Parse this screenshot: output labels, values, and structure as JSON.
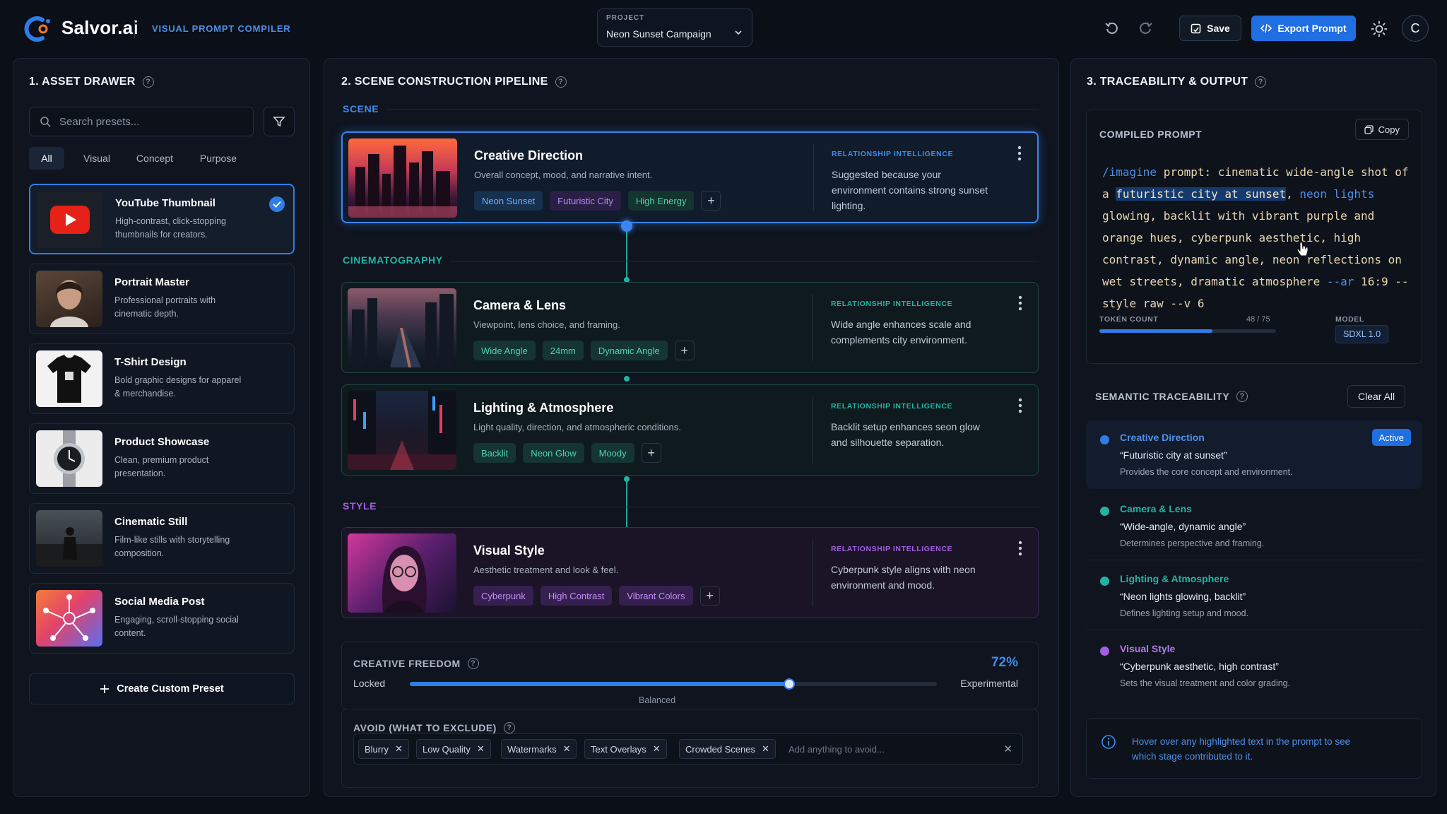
{
  "header": {
    "brand": "Salvor.ai",
    "subtitle": "VISUAL PROMPT COMPILER",
    "project_label": "PROJECT",
    "project_value": "Neon Sunset Campaign",
    "save_label": "Save",
    "export_label": "Export Prompt",
    "avatar_initial": "C"
  },
  "asset_drawer": {
    "title": "1. ASSET DRAWER",
    "search_placeholder": "Search presets...",
    "filters": [
      "All",
      "Visual",
      "Concept",
      "Purpose"
    ],
    "presets": [
      {
        "name": "YouTube Thumbnail",
        "desc": "High-contrast, click-stopping thumbnails for creators.",
        "selected": true
      },
      {
        "name": "Portrait Master",
        "desc": "Professional portraits with cinematic depth."
      },
      {
        "name": "T-Shirt Design",
        "desc": "Bold graphic designs for apparel & merchandise."
      },
      {
        "name": "Product Showcase",
        "desc": "Clean, premium product presentation."
      },
      {
        "name": "Cinematic Still",
        "desc": "Film-like stills with storytelling composition."
      },
      {
        "name": "Social Media Post",
        "desc": "Engaging, scroll-stopping social content."
      }
    ],
    "create_label": "Create Custom Preset"
  },
  "pipeline": {
    "title": "2. SCENE CONSTRUCTION PIPELINE",
    "sections": {
      "scene": "SCENE",
      "cinematography": "CINEMATOGRAPHY",
      "style": "STYLE"
    },
    "ri_label": "RELATIONSHIP INTELLIGENCE",
    "stages": [
      {
        "name": "Creative Direction",
        "desc": "Overall concept, mood, and narrative intent.",
        "tags": [
          "Neon Sunset",
          "Futuristic City",
          "High Energy"
        ],
        "ri": "Suggested because your environment contains strong sunset lighting."
      },
      {
        "name": "Camera & Lens",
        "desc": "Viewpoint, lens choice, and framing.",
        "tags": [
          "Wide Angle",
          "24mm",
          "Dynamic Angle"
        ],
        "ri": "Wide angle enhances scale and complements city environment."
      },
      {
        "name": "Lighting & Atmosphere",
        "desc": "Light quality, direction, and atmospheric conditions.",
        "tags": [
          "Backlit",
          "Neon Glow",
          "Moody"
        ],
        "ri": "Backlit setup enhances seon glow and silhouette separation."
      },
      {
        "name": "Visual Style",
        "desc": "Aesthetic treatment and look & feel.",
        "tags": [
          "Cyberpunk",
          "High Contrast",
          "Vibrant Colors"
        ],
        "ri": "Cyberpunk style aligns with neon environment and mood."
      }
    ],
    "freedom": {
      "label": "CREATIVE FREEDOM",
      "value_text": "72%",
      "value": 0.72,
      "left": "Locked",
      "right": "Experimental",
      "mid": "Balanced"
    },
    "avoid": {
      "label": "AVOID (WHAT TO EXCLUDE)",
      "chips": [
        "Blurry",
        "Low Quality",
        "Watermarks",
        "Text Overlays",
        "Crowded Scenes"
      ],
      "placeholder": "Add anything to avoid..."
    }
  },
  "output": {
    "title": "3. TRACEABILITY & OUTPUT",
    "compiled_label": "COMPILED PROMPT",
    "copy_label": "Copy",
    "prompt": {
      "cmd": "/imagine",
      "p1": " prompt: cinematic wide-angle shot of a ",
      "highlight": "futuristic city at sunset",
      "p2": ", ",
      "neon": "neon lights",
      "p3": " glowing, backlit with vibrant purple and orange hues, cyberpunk aesthetic, high contrast, dynamic angle, neon reflections on wet streets, dramatic atmosphere ",
      "ar": "--ar",
      "p4": " 16:9 --style raw --v 6"
    },
    "token_label": "TOKEN COUNT",
    "token_text": "48 / 75",
    "token_fraction": 0.64,
    "model_label": "MODEL",
    "model_value": "SDXL 1.0",
    "semantic_label": "SEMANTIC TRACEABILITY",
    "clear_label": "Clear All",
    "traces": [
      {
        "name": "Creative Direction",
        "quote": "“Futuristic city at sunset”",
        "desc": "Provides the core concept and environment.",
        "color": "#2f7de6",
        "badge": "Active"
      },
      {
        "name": "Camera & Lens",
        "quote": "“Wide-angle, dynamic angle”",
        "desc": "Determines perspective and framing.",
        "color": "#22b3a4"
      },
      {
        "name": "Lighting & Atmosphere",
        "quote": "“Neon lights glowing, backlit”",
        "desc": "Defines lighting setup and mood.",
        "color": "#22b3a4"
      },
      {
        "name": "Visual Style",
        "quote": "“Cyberpunk aesthetic, high contrast”",
        "desc": "Sets the visual treatment and color grading.",
        "color": "#a35ee0"
      }
    ],
    "hint": "Hover over any highlighted text in the prompt to see which stage contributed to it."
  },
  "colors": {
    "accent": "#1f6fe3",
    "teal": "#22b3a4",
    "purple": "#a35ee0"
  }
}
